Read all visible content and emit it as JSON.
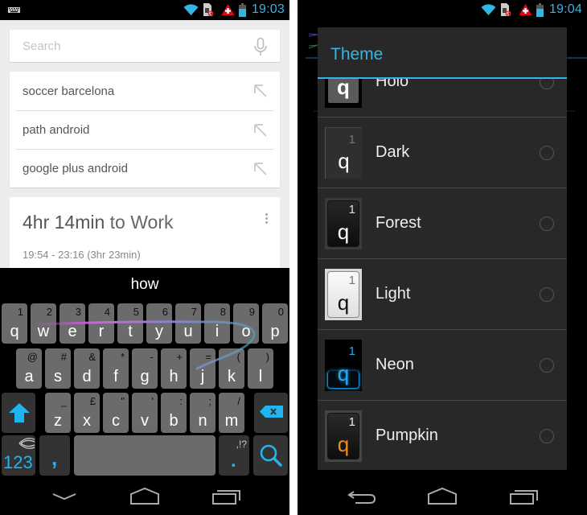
{
  "left_screen": {
    "status_bar": {
      "time": "19:03",
      "icons": [
        "keyboard-notification-icon",
        "wifi-icon",
        "sim-card-blocked-icon",
        "alert-icon",
        "battery-icon"
      ]
    },
    "search": {
      "placeholder": "Search",
      "value": ""
    },
    "suggestions": [
      {
        "text": "soccer barcelona"
      },
      {
        "text": "path android"
      },
      {
        "text": "google plus android"
      }
    ],
    "route_card": {
      "duration": "4hr 14min",
      "destination_text": " to Work",
      "schedule": "19:54 - 23:16 (3hr 23min)"
    },
    "keyboard": {
      "prediction": "how",
      "row1": [
        {
          "main": "q",
          "alt": "1"
        },
        {
          "main": "w",
          "alt": "2"
        },
        {
          "main": "e",
          "alt": "3"
        },
        {
          "main": "r",
          "alt": "4"
        },
        {
          "main": "t",
          "alt": "5"
        },
        {
          "main": "y",
          "alt": "6"
        },
        {
          "main": "u",
          "alt": "7"
        },
        {
          "main": "i",
          "alt": "8"
        },
        {
          "main": "o",
          "alt": "9"
        },
        {
          "main": "p",
          "alt": "0"
        }
      ],
      "row2": [
        {
          "main": "a",
          "alt": "@"
        },
        {
          "main": "s",
          "alt": "#"
        },
        {
          "main": "d",
          "alt": "&"
        },
        {
          "main": "f",
          "alt": "*"
        },
        {
          "main": "g",
          "alt": "-"
        },
        {
          "main": "h",
          "alt": "+"
        },
        {
          "main": "j",
          "alt": "="
        },
        {
          "main": "k",
          "alt": "("
        },
        {
          "main": "l",
          "alt": ")"
        }
      ],
      "row3": [
        {
          "main": "z",
          "alt": "_"
        },
        {
          "main": "x",
          "alt": "£"
        },
        {
          "main": "c",
          "alt": "\""
        },
        {
          "main": "v",
          "alt": "'"
        },
        {
          "main": "b",
          "alt": ":"
        },
        {
          "main": "n",
          "alt": ";"
        },
        {
          "main": "m",
          "alt": "/"
        }
      ],
      "numbers_label": "123",
      "comma_label": ",",
      "period_label": ".",
      "period_alt": ",!?",
      "accent_color": "#1fb5f0"
    },
    "nav": [
      "back-down-icon",
      "home-icon",
      "recents-icon"
    ]
  },
  "right_screen": {
    "status_bar": {
      "time": "19:04",
      "icons": [
        "wifi-icon",
        "sim-card-blocked-icon",
        "alert-icon",
        "battery-icon"
      ]
    },
    "dialog": {
      "title": "Theme",
      "options": [
        {
          "name": "Holo",
          "key_number": "",
          "key_letter": "q",
          "selected": false
        },
        {
          "name": "Dark",
          "key_number": "1",
          "key_letter": "q",
          "selected": false
        },
        {
          "name": "Forest",
          "key_number": "1",
          "key_letter": "q",
          "selected": false
        },
        {
          "name": "Light",
          "key_number": "1",
          "key_letter": "q",
          "selected": false
        },
        {
          "name": "Neon",
          "key_number": "1",
          "key_letter": "q",
          "selected": false
        },
        {
          "name": "Pumpkin",
          "key_number": "1",
          "key_letter": "q",
          "selected": false
        }
      ],
      "accent_color": "#33b5e5"
    },
    "nav": [
      "back-icon",
      "home-icon",
      "recents-icon"
    ]
  }
}
